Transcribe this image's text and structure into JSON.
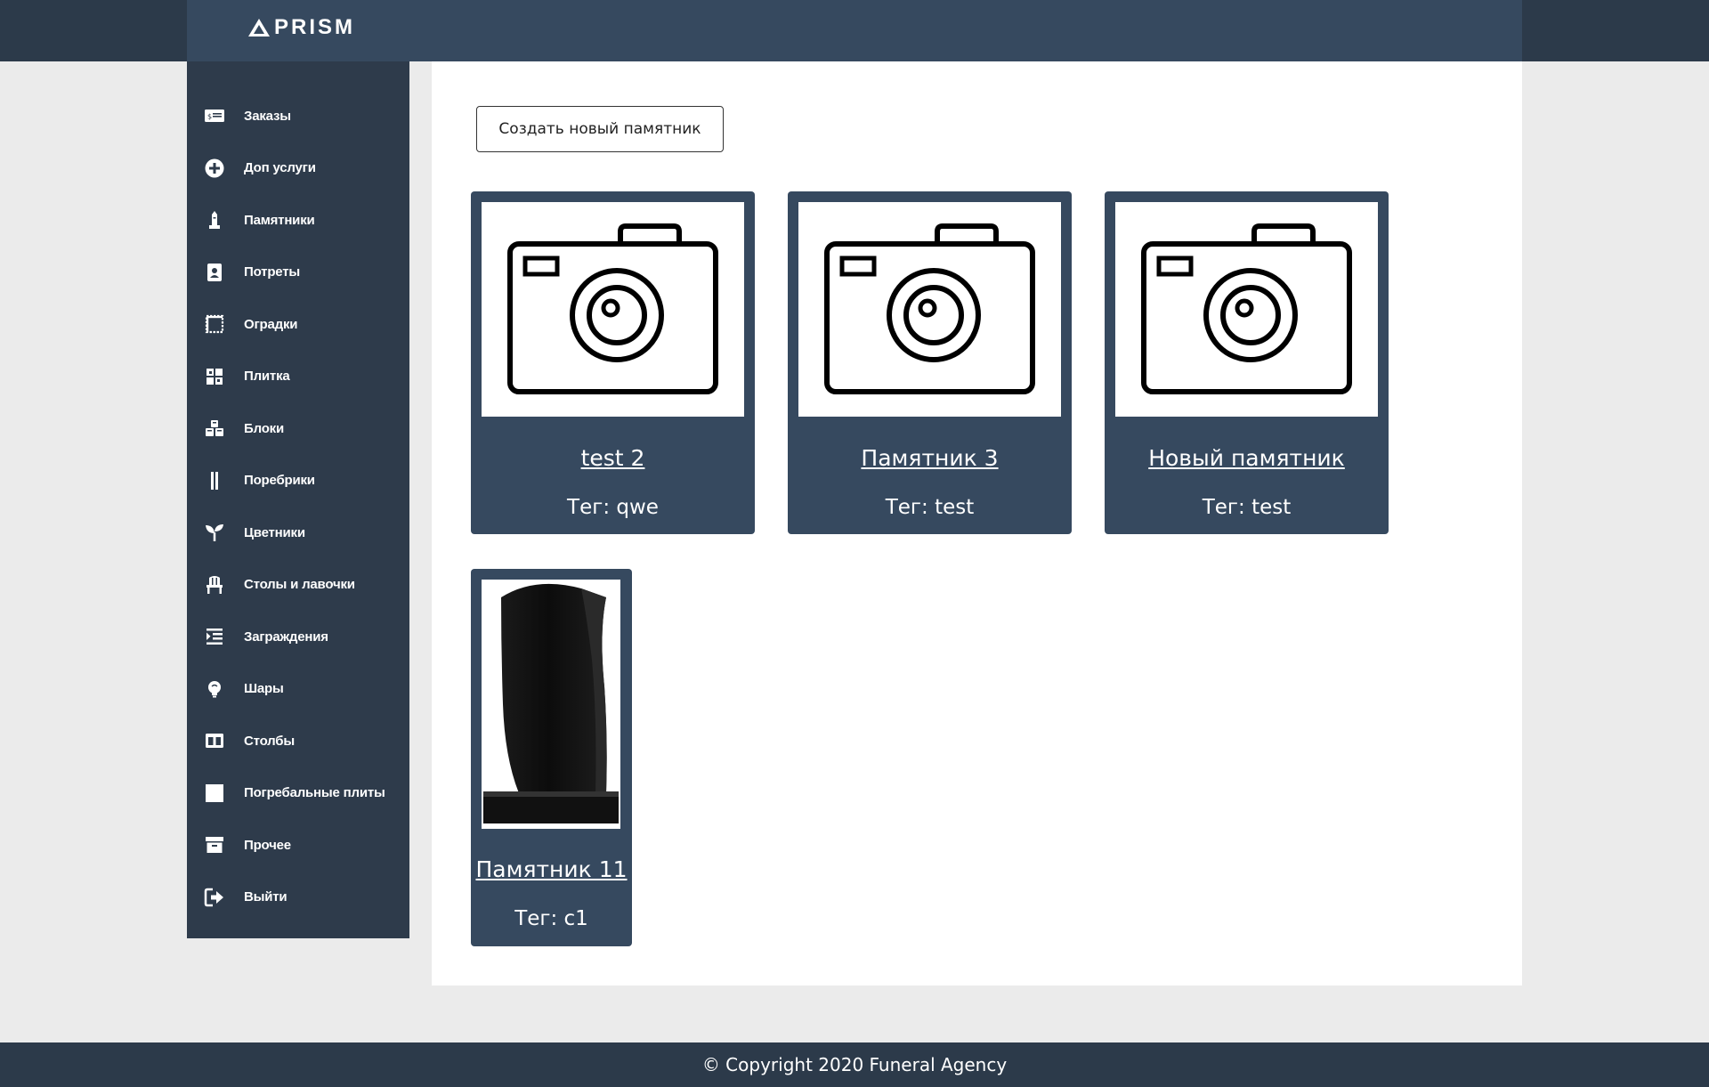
{
  "header": {
    "logo_text": "PRISM"
  },
  "sidebar": {
    "items": [
      {
        "label": "Заказы",
        "icon": "money-bill-icon"
      },
      {
        "label": "Доп услуги",
        "icon": "plus-circle-icon"
      },
      {
        "label": "Памятники",
        "icon": "monument-icon"
      },
      {
        "label": "Потреты",
        "icon": "portrait-icon"
      },
      {
        "label": "Оградки",
        "icon": "fence-icon"
      },
      {
        "label": "Плитка",
        "icon": "tiles-icon"
      },
      {
        "label": "Блоки",
        "icon": "cubes-icon"
      },
      {
        "label": "Поребрики",
        "icon": "curb-icon"
      },
      {
        "label": "Цветники",
        "icon": "seedling-icon"
      },
      {
        "label": "Столы и лавочки",
        "icon": "chair-icon"
      },
      {
        "label": "Заграждения",
        "icon": "list-indent-icon"
      },
      {
        "label": "Шары",
        "icon": "lightbulb-icon"
      },
      {
        "label": "Столбы",
        "icon": "columns-icon"
      },
      {
        "label": "Погребальные плиты",
        "icon": "square-icon"
      },
      {
        "label": "Прочее",
        "icon": "archive-icon"
      },
      {
        "label": "Выйти",
        "icon": "sign-out-icon"
      }
    ]
  },
  "main": {
    "create_button": "Создать новый памятник",
    "cards": [
      {
        "title": "test 2",
        "tag": "Тег: qwe",
        "image": "camera-placeholder-icon"
      },
      {
        "title": "Памятник 3",
        "tag": "Тег: test",
        "image": "camera-placeholder-icon"
      },
      {
        "title": "Новый памятник",
        "tag": "Тег: test",
        "image": "camera-placeholder-icon"
      },
      {
        "title": "Памятник 11",
        "tag": "Тег: с1",
        "image": "black-headstone"
      }
    ]
  },
  "footer": {
    "copyright": "© Copyright 2020 Funeral Agency"
  },
  "colors": {
    "header": "#2c3a4a",
    "brand_bar": "#36495f",
    "sidebar": "#2e3b4b",
    "card": "#36495f",
    "page_bg": "#ebebeb"
  }
}
